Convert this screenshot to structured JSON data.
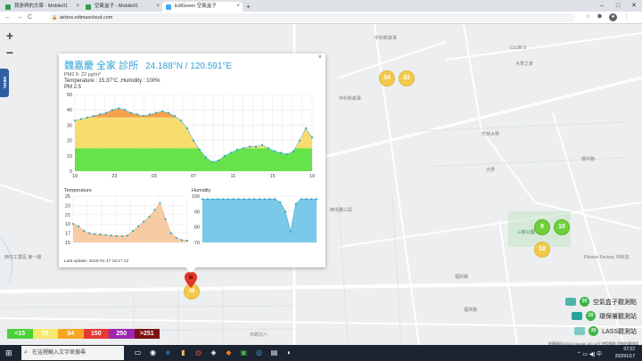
{
  "browser": {
    "tabs": [
      {
        "label": "我參與的文章 - Mobile01",
        "active": false,
        "color": "#2e9e4a"
      },
      {
        "label": "空氣盒子 - Mobile01",
        "active": false,
        "color": "#2e9e4a"
      },
      {
        "label": "EdiGreen 空氣盒子",
        "active": true,
        "color": "#3fa9f5"
      }
    ],
    "new_tab": "+",
    "window_controls": [
      "–",
      "□",
      "✕"
    ],
    "nav": {
      "back": "←",
      "forward": "→",
      "reload": "C"
    },
    "url": "airbox.edimaxcloud.com",
    "lock": "🔒",
    "right_icons": [
      "☆",
      "⬢",
      "●",
      "⋮"
    ]
  },
  "map": {
    "zoom_in": "+",
    "zoom_out": "−",
    "menu_label": "MENU",
    "markers_yellow": [
      "34",
      "33",
      "18"
    ],
    "markers_green": [
      "9",
      "10"
    ],
    "selected_marker": "38",
    "labels": [
      "CLUB S",
      "大學之家",
      "中科新故事",
      "中科新故事",
      "竹林大學",
      "大學",
      "西屯路三段",
      "環中路",
      "三和公園",
      "Fitness Factory 中科店",
      "福科路",
      "福林路",
      "西屯工業區 第一路",
      "市政北八"
    ]
  },
  "popup": {
    "title": "魏嘉慶 全家 診所",
    "coords": "24.188°N / 120.591°E",
    "pm25_line": "PM2.5: 22 μg/m³",
    "temp_line": "Temperature : 15.37°C ,Humidity : 100%",
    "pm_heading": "PM 2.5",
    "temperature_heading": "Temperature",
    "humidity_heading": "Humidity",
    "last_update": "Last update: 2020-01-17 19:17:12",
    "close": "×"
  },
  "chart_data": [
    {
      "type": "area",
      "title": "PM 2.5",
      "x_ticks": [
        "19",
        "23",
        "03",
        "07",
        "11",
        "15",
        "19"
      ],
      "ylim": [
        0,
        50
      ],
      "y_ticks": [
        0,
        10,
        20,
        30,
        40,
        50
      ],
      "values": [
        33,
        34,
        35,
        36,
        37,
        38,
        40,
        41,
        40,
        38,
        37,
        36,
        37,
        38,
        39,
        38,
        36,
        33,
        28,
        20,
        14,
        9,
        6,
        7,
        10,
        12,
        14,
        15,
        16,
        16,
        17,
        15,
        13,
        12,
        11,
        13,
        20,
        28,
        22
      ]
    },
    {
      "type": "area",
      "title": "Temperature",
      "ylim": [
        15,
        25
      ],
      "y_ticks": [
        15,
        17,
        19,
        21,
        23,
        25
      ],
      "values": [
        19,
        18.5,
        17.5,
        17,
        16.8,
        16.7,
        16.6,
        16.5,
        16.4,
        16.4,
        16.5,
        17.5,
        18.5,
        19.5,
        20.5,
        22,
        23.5,
        20,
        17,
        16,
        15.5,
        15.4
      ]
    },
    {
      "type": "area",
      "title": "Humidity",
      "ylim": [
        70,
        100
      ],
      "y_ticks": [
        70,
        80,
        90,
        100
      ],
      "values": [
        98,
        98,
        98,
        98,
        98,
        98,
        98,
        98,
        98,
        98,
        98,
        98,
        98,
        98,
        98,
        96,
        90,
        77,
        95,
        98,
        98,
        98,
        98
      ]
    }
  ],
  "legend": [
    {
      "label": "<15",
      "color": "#4cd137"
    },
    {
      "label": "35",
      "color": "#f6e96b"
    },
    {
      "label": "54",
      "color": "#f5a623"
    },
    {
      "label": "150",
      "color": "#e53935"
    },
    {
      "label": "250",
      "color": "#9c27b0"
    },
    {
      "label": ">251",
      "color": "#7b1212"
    }
  ],
  "right_legend": [
    {
      "label": "空氣盒子觀測點",
      "value": "20"
    },
    {
      "label": "環保署觀測站",
      "value": "20"
    },
    {
      "label": "LASS觀測站",
      "value": "20"
    }
  ],
  "attribution": "地圖資料©2020 Google   100 公尺   使用條款   回報地圖錯誤",
  "taskbar": {
    "start": "⊞",
    "search_placeholder": "在這裡輸入文字來搜尋",
    "apps": [
      "▭",
      "◉",
      "e",
      "▮",
      "◍",
      "◈",
      "◆",
      "▣",
      "◎",
      "▤",
      "◐"
    ],
    "time": "07:22",
    "date": "2020/1/17",
    "tray_icons": "⌃ ▭ ◀) 中"
  }
}
